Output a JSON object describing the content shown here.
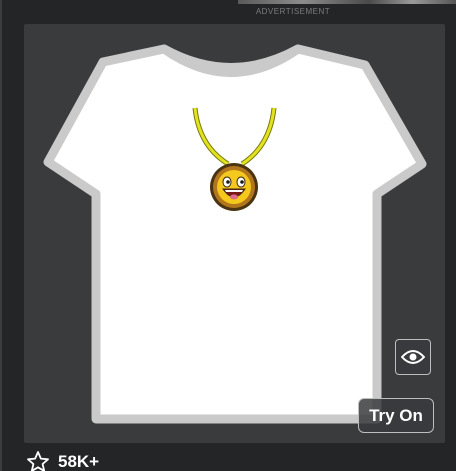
{
  "ad": {
    "label": "ADVERTISEMENT"
  },
  "item": {
    "thumbnail_icon": "t-shirt-with-smiley-pendant",
    "favorite_count": "58K+"
  },
  "buttons": {
    "view_icon": "eye-icon",
    "try_on_label": "Try On"
  },
  "colors": {
    "background": "#232527",
    "card": "#393b3d",
    "shirt": "#ffffff",
    "shirt_outline": "#c9c9c9",
    "chain": "#d4d41a",
    "pendant": "#e8b720"
  }
}
